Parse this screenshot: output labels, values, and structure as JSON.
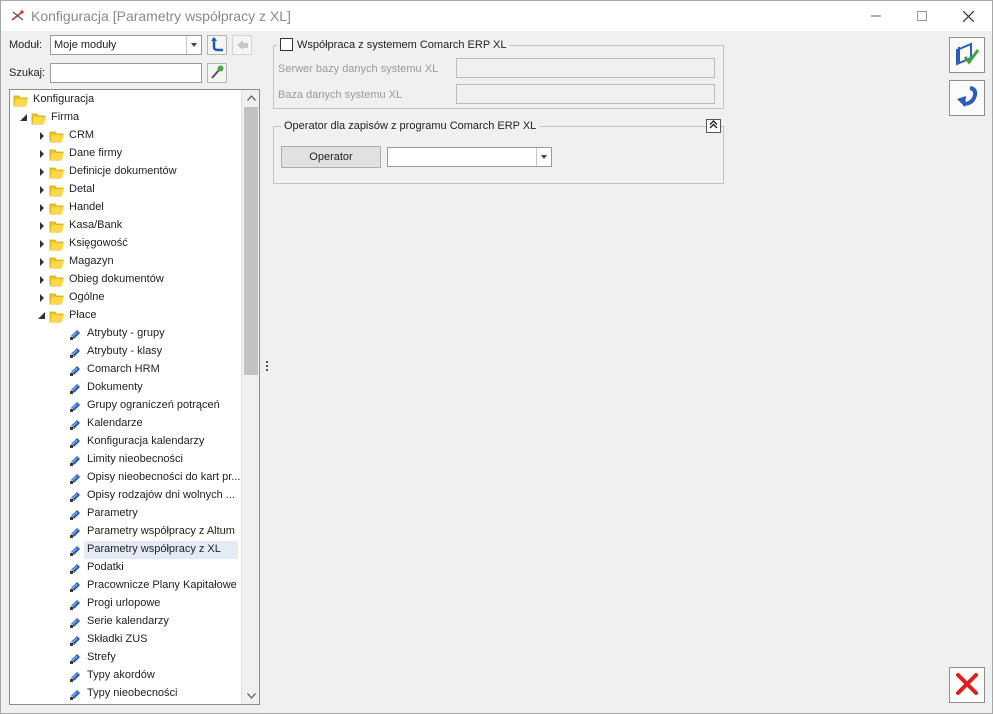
{
  "window": {
    "title": "Konfiguracja [Parametry współpracy z XL]",
    "icons": {
      "app": "app-config-icon",
      "minimize": "minimize-icon",
      "maximize": "maximize-icon",
      "close": "close-icon"
    }
  },
  "toolbar": {
    "module_label": "Moduł:",
    "module_value": "Moje moduły",
    "search_label": "Szukaj:",
    "search_value": "",
    "icons": {
      "refresh": "refresh-icon",
      "back": "back-icon",
      "search": "eyedropper-search-icon"
    }
  },
  "tree": {
    "root": "Konfiguracja",
    "firma": "Firma",
    "groups": [
      "CRM",
      "Dane firmy",
      "Definicje dokumentów",
      "Detal",
      "Handel",
      "Kasa/Bank",
      "Księgowość",
      "Magazyn",
      "Obieg dokumentów",
      "Ogólne",
      "Płace"
    ],
    "place_items": [
      "Atrybuty - grupy",
      "Atrybuty - klasy",
      "Comarch HRM",
      "Dokumenty",
      "Grupy ograniczeń potrąceń",
      "Kalendarze",
      "Konfiguracja kalendarzy",
      "Limity nieobecności",
      "Opisy nieobecności do kart pr...",
      "Opisy rodzajów dni wolnych ...",
      "Parametry",
      "Parametry współpracy z Altum",
      "Parametry współpracy z XL",
      "Podatki",
      "Pracownicze Plany Kapitałowe",
      "Progi urlopowe",
      "Serie kalendarzy",
      "Składki ZUS",
      "Strefy",
      "Typy akordów",
      "Typy nieobecności"
    ],
    "selected": "Parametry współpracy z XL",
    "icons": {
      "folder": "folder-icon",
      "leaf": "settings-item-icon",
      "expand": "expand-arrow-icon",
      "collapse": "collapse-arrow-icon"
    }
  },
  "group_erp": {
    "checkbox_label": "Współpraca z systemem Comarch ERP XL",
    "checked": false,
    "server_label": "Serwer bazy danych systemu XL",
    "server_value": "",
    "db_label": "Baza danych systemu XL",
    "db_value": ""
  },
  "group_operator": {
    "legend": "Operator dla zapisów z programu Comarch ERP XL",
    "operator_button": "Operator",
    "operator_value": "",
    "collapse_icon": "double-chevron-up-icon"
  },
  "actions": {
    "save_icon": "save-icon",
    "undo_icon": "undo-icon",
    "cancel_icon": "cancel-x-icon"
  },
  "colors": {
    "folder": "#f5c518",
    "leaf": "#2a5bbd",
    "selection": "#e5ebf5",
    "cancel": "#e01e1e",
    "save_accent": "#2a5bbd"
  }
}
